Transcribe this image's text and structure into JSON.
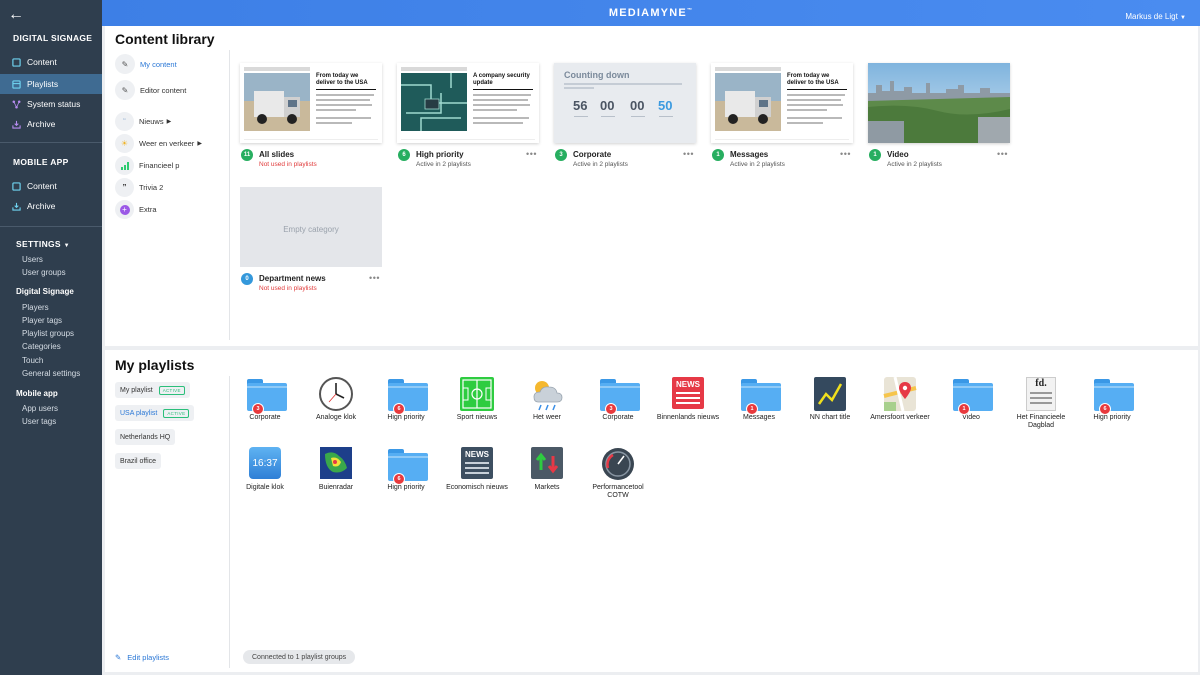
{
  "topbar": {
    "brand": "MEDIAMYNE",
    "brand_mark": "™",
    "user": "Markus de Ligt"
  },
  "sidebar": {
    "digital_signage_title": "DIGITAL SIGNAGE",
    "ds_items": [
      {
        "label": "Content",
        "active": false
      },
      {
        "label": "Playlists",
        "active": true
      },
      {
        "label": "System status",
        "active": false
      },
      {
        "label": "Archive",
        "active": false
      }
    ],
    "mobile_app_title": "MOBILE APP",
    "mobile_items": [
      {
        "label": "Content"
      },
      {
        "label": "Archive"
      }
    ],
    "settings_title": "SETTINGS",
    "settings_users": [
      "Users",
      "User groups"
    ],
    "ds_settings_head": "Digital Signage",
    "ds_settings": [
      "Players",
      "Player tags",
      "Playlist groups",
      "Categories",
      "Touch",
      "General settings"
    ],
    "mobile_settings_head": "Mobile app",
    "mobile_settings": [
      "App users",
      "User tags"
    ]
  },
  "library": {
    "title": "Content library",
    "nav_main": [
      {
        "label": "My content",
        "active": true
      },
      {
        "label": "Editor content",
        "active": false
      }
    ],
    "nav_feeds": [
      {
        "label": "Nieuws",
        "icon": "quote-icon",
        "arrow": true
      },
      {
        "label": "Weer en verkeer",
        "icon": "weather-icon",
        "arrow": true
      },
      {
        "label": "Financieel p",
        "icon": "bars-icon",
        "arrow": false
      },
      {
        "label": "Trivia 2",
        "icon": "quote-icon",
        "arrow": false
      },
      {
        "label": "Extra",
        "icon": "plus-icon",
        "arrow": false
      }
    ],
    "cards": [
      {
        "name": "All slides",
        "count": "11",
        "status": "Not used in playlists",
        "status_red": true,
        "kind": "slide-truck",
        "heading": "From today we deliver to the USA"
      },
      {
        "name": "High priority",
        "count": "6",
        "status": "Active in 2 playlists",
        "status_red": false,
        "kind": "slide-circuit",
        "heading": "A company security update"
      },
      {
        "name": "Corporate",
        "count": "3",
        "status": "Active in 2 playlists",
        "status_red": false,
        "kind": "counting",
        "heading": "Counting down",
        "numbers": [
          "56",
          "00",
          "00",
          "50"
        ]
      },
      {
        "name": "Messages",
        "count": "1",
        "status": "Active in 2 playlists",
        "status_red": false,
        "kind": "slide-truck",
        "heading": "From today we deliver to the USA"
      },
      {
        "name": "Video",
        "count": "1",
        "status": "Active in 2 playlists",
        "status_red": false,
        "kind": "video"
      }
    ],
    "empty_card": {
      "name": "Department news",
      "count": "0",
      "status": "Not used in playlists",
      "placeholder": "Empty category"
    }
  },
  "playlists": {
    "title": "My playlists",
    "chips": [
      {
        "label": "My playlist",
        "badge": "ACTIVE"
      },
      {
        "label": "USA playlist",
        "badge": "ACTIVE"
      },
      {
        "label": "Netherlands HQ",
        "badge": ""
      },
      {
        "label": "Brazil office",
        "badge": ""
      }
    ],
    "edit_label": "Edit playlists",
    "connected_label": "Connected to 1 playlist groups",
    "tiles_row1": [
      {
        "label": "Corporate",
        "icon": "folder-icon",
        "count": "3"
      },
      {
        "label": "Analoge klok",
        "icon": "clock-icon"
      },
      {
        "label": "High priority",
        "icon": "folder-icon",
        "count": "6"
      },
      {
        "label": "Sport nieuws",
        "icon": "soccer-field-icon"
      },
      {
        "label": "Het weer",
        "icon": "weather-icon"
      },
      {
        "label": "Corporate",
        "icon": "folder-icon",
        "count": "3"
      },
      {
        "label": "Binnenlands nieuws",
        "icon": "news-icon",
        "text": "NEWS"
      },
      {
        "label": "Messages",
        "icon": "folder-icon",
        "count": "1"
      },
      {
        "label": "NN chart title",
        "icon": "chart-icon"
      },
      {
        "label": "Amersfoort verkeer",
        "icon": "map-icon"
      },
      {
        "label": "Video",
        "icon": "folder-icon",
        "count": "1"
      },
      {
        "label": "Het Financieele Dagblad",
        "icon": "fd-icon",
        "text": "fd."
      },
      {
        "label": "High priority",
        "icon": "folder-icon",
        "count": "6"
      }
    ],
    "tiles_row2": [
      {
        "label": "Digitale klok",
        "icon": "digital-clock-icon",
        "text": "16:37"
      },
      {
        "label": "Buienradar",
        "icon": "radar-icon"
      },
      {
        "label": "High priority",
        "icon": "folder-icon",
        "count": "6"
      },
      {
        "label": "Economisch nieuws",
        "icon": "news-dark-icon",
        "text": "NEWS"
      },
      {
        "label": "Markets",
        "icon": "markets-icon"
      },
      {
        "label": "Performancetool COTW",
        "icon": "gauge-icon"
      }
    ]
  }
}
